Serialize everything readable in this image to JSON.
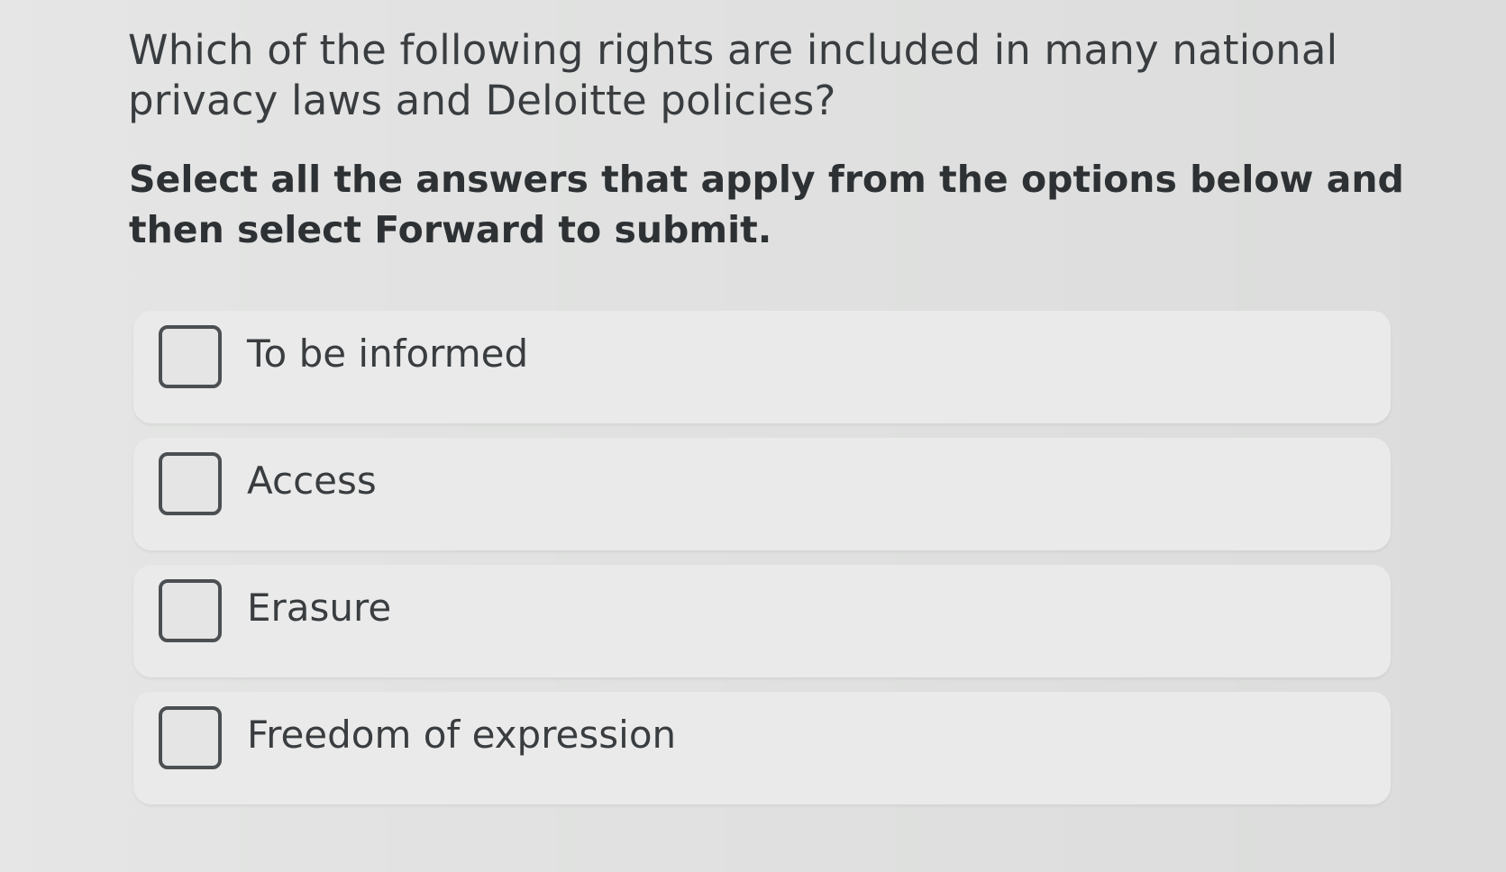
{
  "question": {
    "prompt": "Which of the following rights are included in many national privacy laws and Deloitte policies?",
    "instruction": "Select all the answers that apply from the options below and then select Forward to submit."
  },
  "options": [
    {
      "label": "To be informed",
      "checked": false
    },
    {
      "label": "Access",
      "checked": false
    },
    {
      "label": "Erasure",
      "checked": false
    },
    {
      "label": "Freedom of expression",
      "checked": false
    }
  ]
}
